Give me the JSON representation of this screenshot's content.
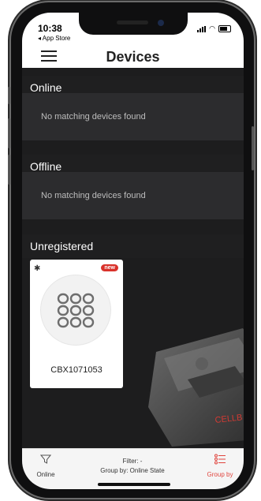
{
  "status_bar": {
    "time": "10:38",
    "back_app": "◂ App Store"
  },
  "header": {
    "title": "Devices"
  },
  "sections": [
    {
      "name": "Online",
      "empty_text": "No matching devices found"
    },
    {
      "name": "Offline",
      "empty_text": "No matching devices found"
    },
    {
      "name": "Unregistered"
    }
  ],
  "device_card": {
    "badge": "new",
    "name": "CBX1071053"
  },
  "bottom_bar": {
    "online_label": "Online",
    "filter_line1": "Filter: -",
    "filter_line2": "Group by: Online State",
    "groupby_label": "Group by"
  },
  "colors": {
    "accent": "#e0443d",
    "badge": "#d9322b",
    "dark_bg": "#1d1d1e",
    "panel": "#2c2c2e"
  },
  "icons": [
    "hamburger-icon",
    "bluetooth-icon",
    "device-keypad-icon",
    "filter-funnel-icon",
    "group-list-icon"
  ]
}
